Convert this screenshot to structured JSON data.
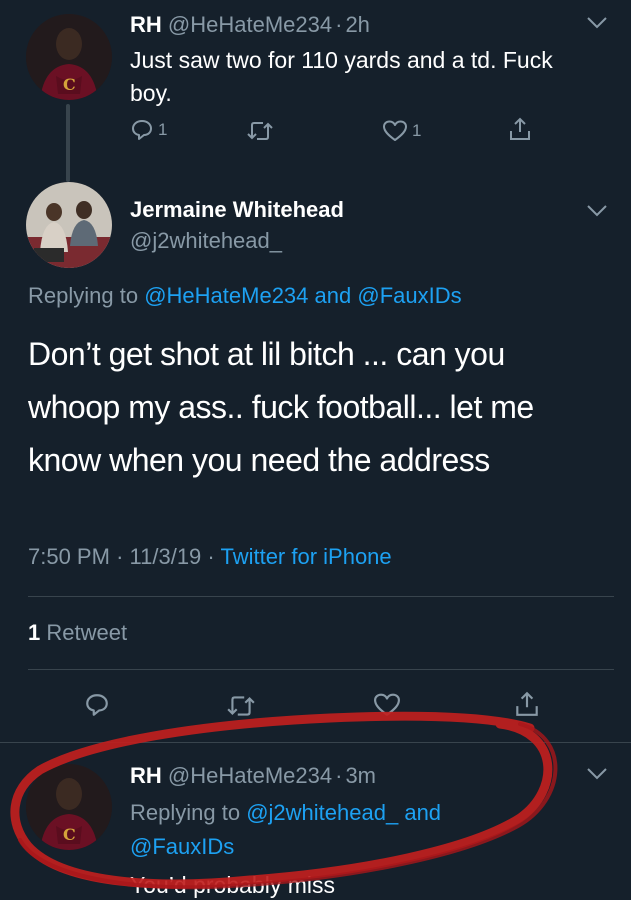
{
  "tweet1": {
    "name": "RH",
    "handle": "@HeHateMe234",
    "sep": "·",
    "time": "2h",
    "text_line1": "Just saw two for 110 yards and a td. Fuck",
    "text_line2": "boy.",
    "reply_count": "1",
    "like_count": "1"
  },
  "main_tweet": {
    "name": "Jermaine Whitehead",
    "handle": "@j2whitehead_",
    "replying_prefix": "Replying to",
    "reply_handle1": "@HeHateMe234",
    "reply_and": "and",
    "reply_handle2": "@FauxIDs",
    "text_line1": "Don’t get shot at lil bitch ... can you",
    "text_line2": "whoop my ass.. fuck football... let me",
    "text_line3": "know when you need the address",
    "time": "7:50 PM",
    "sep1": "·",
    "date": "11/3/19",
    "sep2": "·",
    "source": "Twitter for iPhone",
    "retweet_count": "1",
    "retweet_label": "Retweet"
  },
  "reply_tweet": {
    "name": "RH",
    "handle": "@HeHateMe234",
    "sep": "·",
    "time": "3m",
    "replying_prefix": "Replying to",
    "reply_handle1": "@j2whitehead_",
    "reply_and": "and",
    "reply_handle2": "@FauxIDs",
    "text": "You’d probably miss"
  },
  "colors": {
    "background": "#15202b",
    "muted": "#8899a6",
    "link": "#1da1f2",
    "divider": "#38444d",
    "annotation_red": "#c0201e"
  },
  "icons": [
    "chevron-down-icon",
    "reply-icon",
    "retweet-icon",
    "like-icon",
    "share-icon"
  ]
}
